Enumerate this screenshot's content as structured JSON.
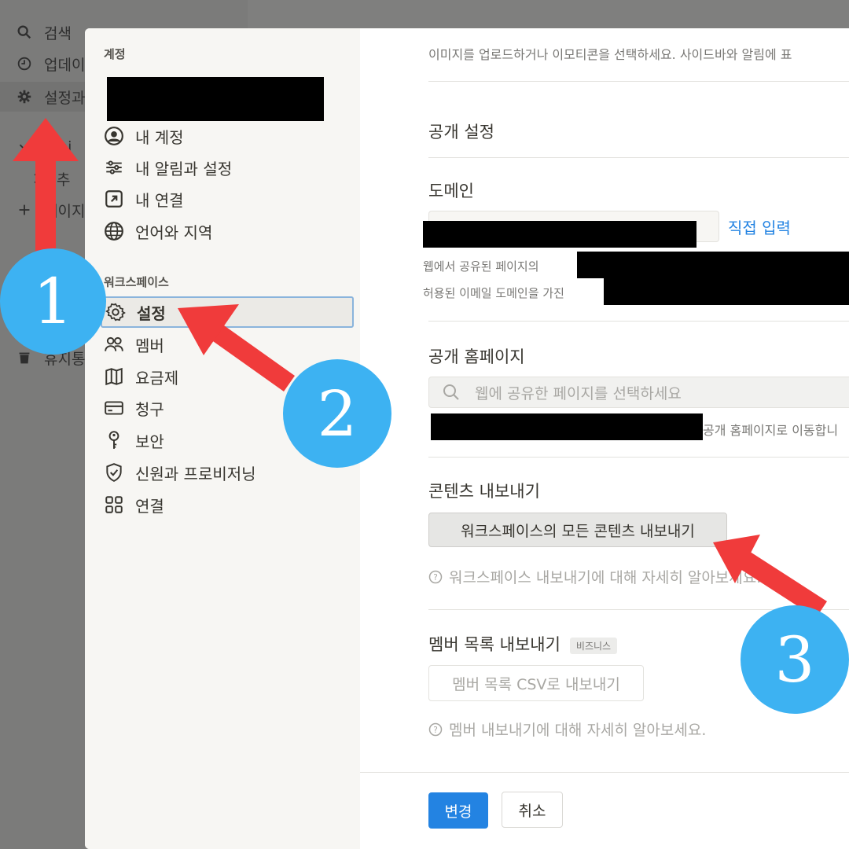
{
  "background_sidebar": {
    "items": [
      {
        "label": "검색",
        "icon": "search-icon"
      },
      {
        "label": "업데이트",
        "icon": "clock-icon"
      },
      {
        "label": "설정과",
        "icon": "gear-icon"
      },
      {
        "label": "Proj",
        "icon": "chevron-down-icon"
      },
      {
        "label": "추",
        "icon": "chevron-right-icon"
      },
      {
        "label": "페이지",
        "icon": "plus-icon"
      },
      {
        "label": "휴지통",
        "icon": "trash-icon"
      }
    ]
  },
  "modal": {
    "sidebar": {
      "account_heading": "계정",
      "account_items": [
        {
          "label": "내 계정",
          "icon": "user-circle-icon"
        },
        {
          "label": "내 알림과 설정",
          "icon": "sliders-icon"
        },
        {
          "label": "내 연결",
          "icon": "external-link-icon"
        },
        {
          "label": "언어와 지역",
          "icon": "globe-icon"
        }
      ],
      "workspace_heading": "워크스페이스",
      "workspace_items": [
        {
          "label": "설정",
          "icon": "gear-icon",
          "active": true
        },
        {
          "label": "멤버",
          "icon": "people-icon"
        },
        {
          "label": "요금제",
          "icon": "map-icon"
        },
        {
          "label": "청구",
          "icon": "credit-card-icon"
        },
        {
          "label": "보안",
          "icon": "key-icon"
        },
        {
          "label": "신원과 프로비저닝",
          "icon": "shield-check-icon"
        },
        {
          "label": "연결",
          "icon": "grid-icon"
        }
      ]
    },
    "content": {
      "icon_desc": "이미지를 업로드하거나 이모티콘을 선택하세요. 사이드바와 알림에 표",
      "public_settings_title": "공개 설정",
      "domain_title": "도메인",
      "domain_link": "직접 입력",
      "domain_note_1": "웹에서 공유된 페이지의",
      "domain_note_2": "허용된 이메일 도메인을 가진",
      "public_home_title": "공개 홈페이지",
      "public_home_placeholder": "웹에 공유한 페이지를 선택하세요",
      "public_home_note": "공개 홈페이지로 이동합니",
      "export_title": "콘텐츠 내보내기",
      "export_button": "워크스페이스의 모든 콘텐츠 내보내기",
      "export_help": "워크스페이스 내보내기에 대해 자세히 알아보세요.",
      "member_export_title": "멤버 목록 내보내기",
      "member_export_badge": "비즈니스",
      "member_export_button": "멤버 목록 CSV로 내보내기",
      "member_export_help": "멤버 내보내기에 대해 자세히 알아보세요.",
      "save_button": "변경",
      "cancel_button": "취소"
    }
  },
  "annotations": [
    {
      "number": "1"
    },
    {
      "number": "2"
    },
    {
      "number": "3"
    }
  ],
  "colors": {
    "accent": "#2383e2",
    "arrow": "#f03b3b",
    "badge_circle": "#3db2f2",
    "overlay": "#7f7f7e"
  }
}
